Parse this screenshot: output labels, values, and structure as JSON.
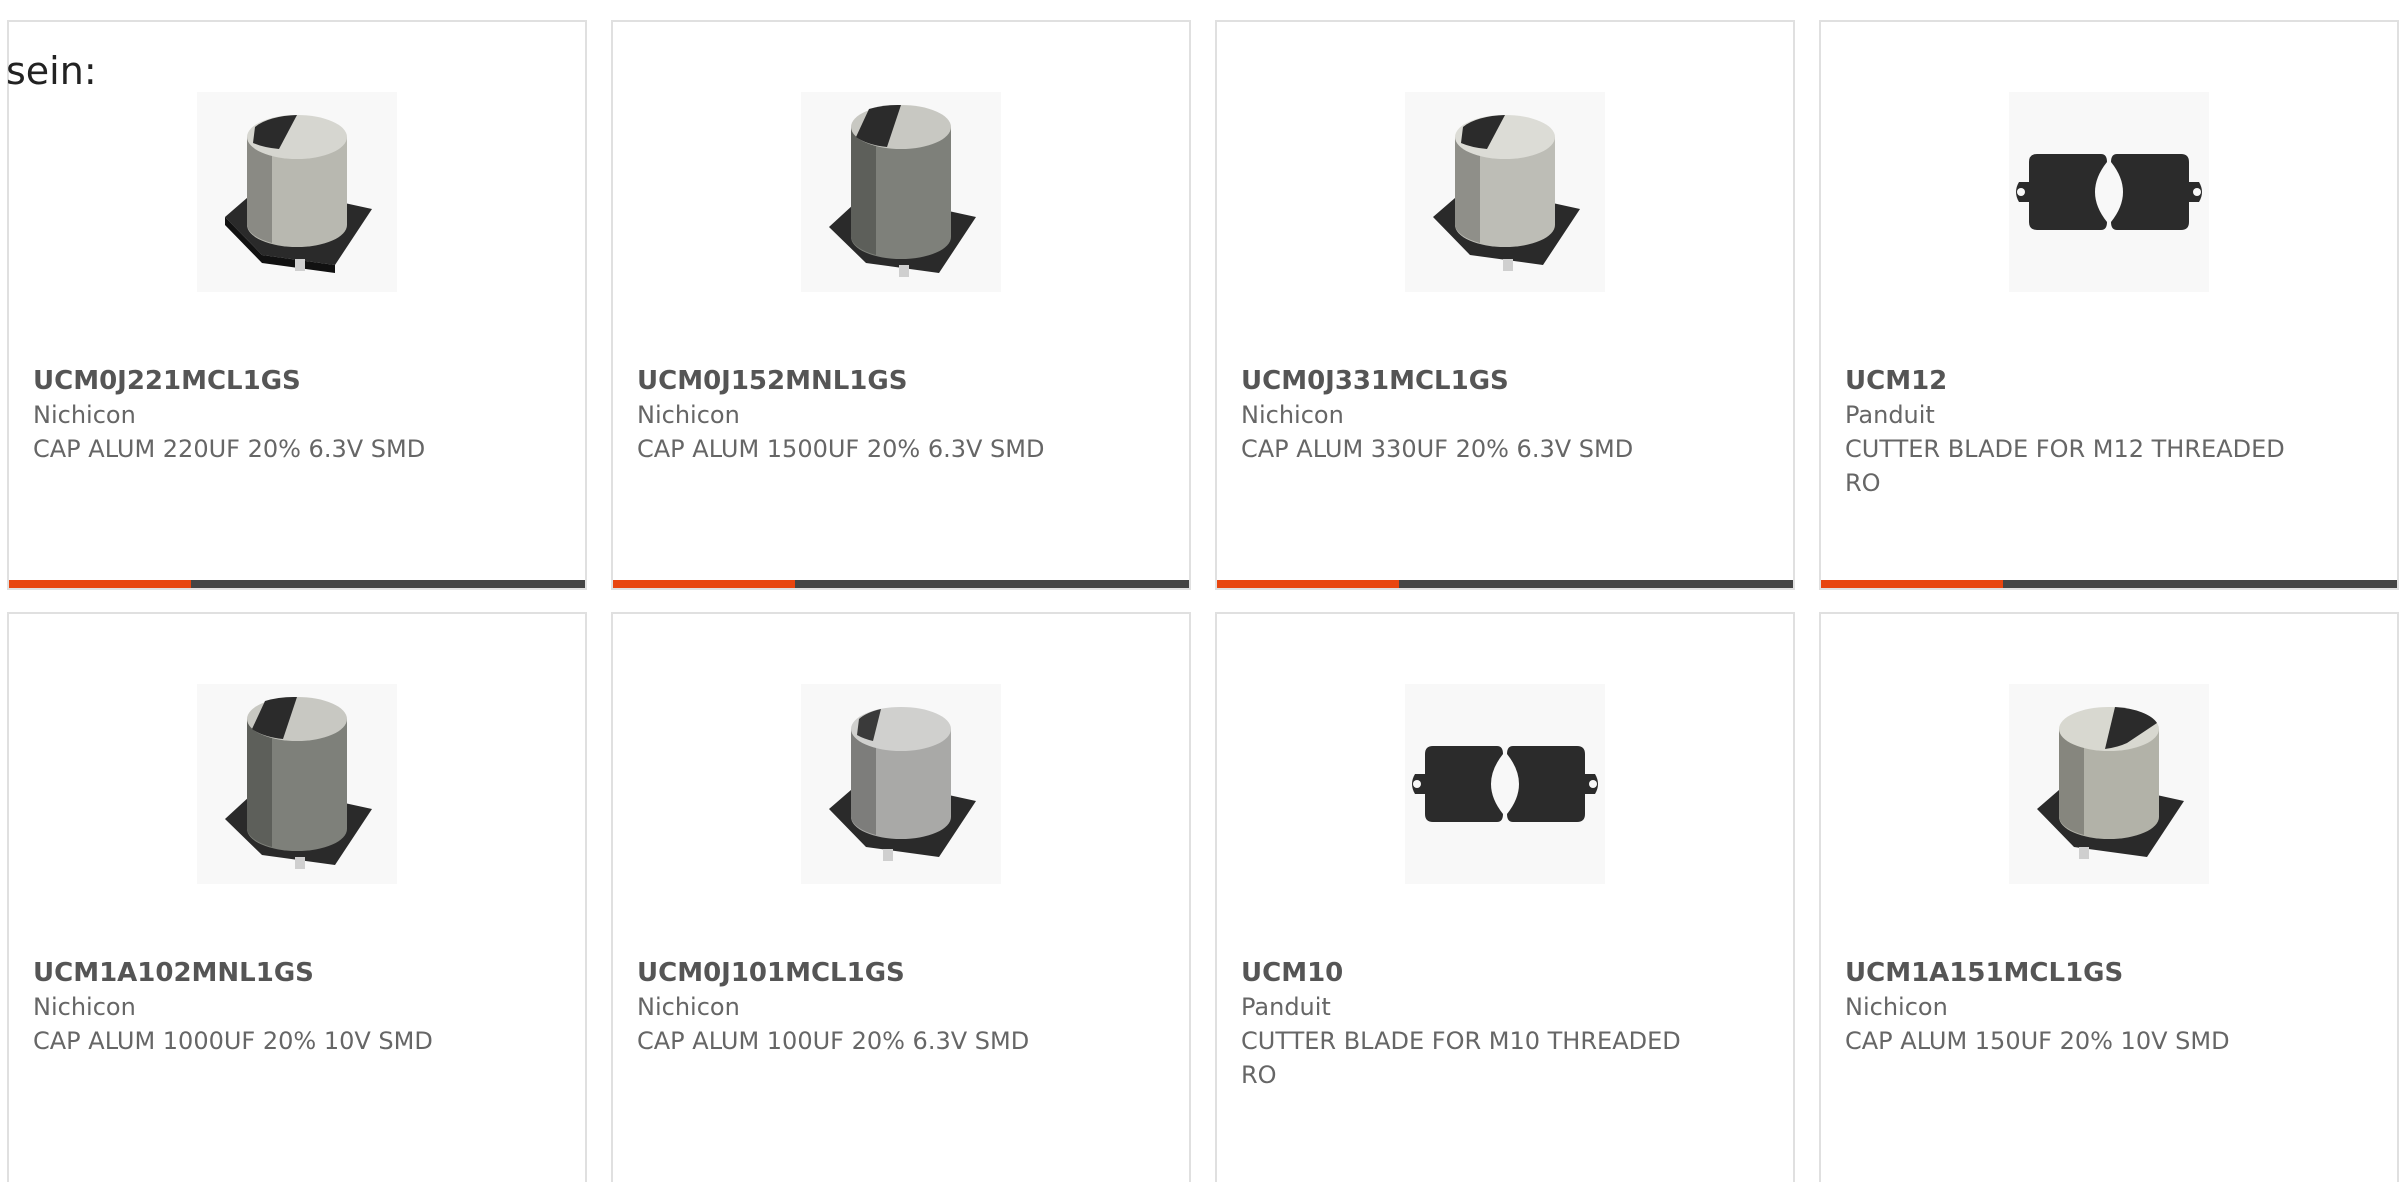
{
  "lead_text": "sein:",
  "accent_colors": {
    "primary": "#e8450f",
    "track": "#444444"
  },
  "products": [
    {
      "part": "UCM0J221MCL1GS",
      "brand": "Nichicon",
      "desc": "CAP ALUM 220UF 20% 6.3V SMD",
      "icon": "smd-capacitor-icon"
    },
    {
      "part": "UCM0J152MNL1GS",
      "brand": "Nichicon",
      "desc": "CAP ALUM 1500UF 20% 6.3V SMD",
      "icon": "smd-capacitor-icon"
    },
    {
      "part": "UCM0J331MCL1GS",
      "brand": "Nichicon",
      "desc": "CAP ALUM 330UF 20% 6.3V SMD",
      "icon": "smd-capacitor-icon"
    },
    {
      "part": "UCM12",
      "brand": "Panduit",
      "desc": "CUTTER BLADE FOR M12 THREADED RO",
      "icon": "cutter-blade-icon"
    },
    {
      "part": "UCM1A102MNL1GS",
      "brand": "Nichicon",
      "desc": "CAP ALUM 1000UF 20% 10V SMD",
      "icon": "smd-capacitor-icon"
    },
    {
      "part": "UCM0J101MCL1GS",
      "brand": "Nichicon",
      "desc": "CAP ALUM 100UF 20% 6.3V SMD",
      "icon": "smd-capacitor-icon"
    },
    {
      "part": "UCM10",
      "brand": "Panduit",
      "desc": "CUTTER BLADE FOR M10 THREADED RO",
      "icon": "cutter-blade-icon"
    },
    {
      "part": "UCM1A151MCL1GS",
      "brand": "Nichicon",
      "desc": "CAP ALUM 150UF 20% 10V SMD",
      "icon": "smd-capacitor-icon"
    }
  ]
}
